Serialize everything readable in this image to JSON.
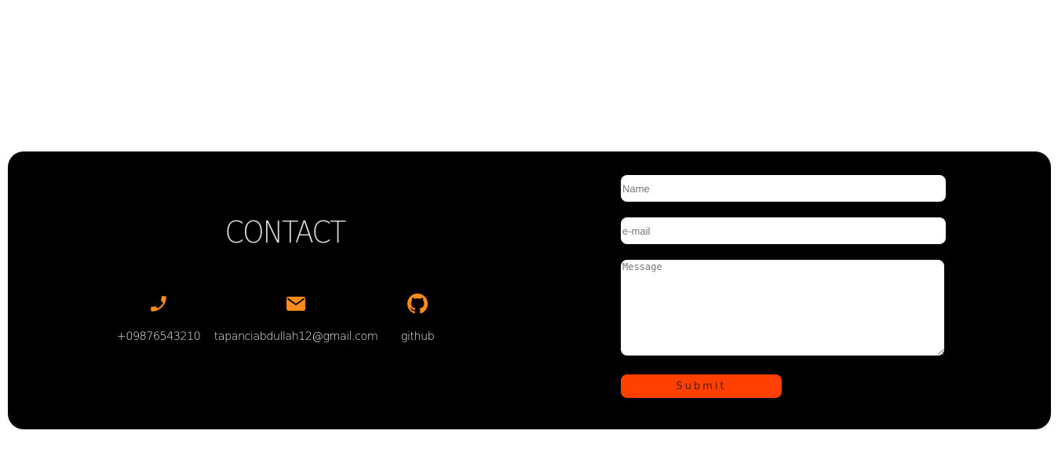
{
  "colors": {
    "section_bg": "#000000",
    "icon_accent": "#ff8c1a",
    "submit_bg": "#ff4000",
    "page_bg": "#ffffff"
  },
  "contact": {
    "title": "CONTACT",
    "items": [
      {
        "icon": "phone-icon",
        "label": "+09876543210"
      },
      {
        "icon": "envelope-icon",
        "label": "tapanciabdullah12@gmail.com"
      },
      {
        "icon": "github-icon",
        "label": "github"
      }
    ]
  },
  "form": {
    "name_placeholder": "Name",
    "email_placeholder": "e-mail",
    "message_placeholder": "Message",
    "submit_label": "Submit"
  }
}
